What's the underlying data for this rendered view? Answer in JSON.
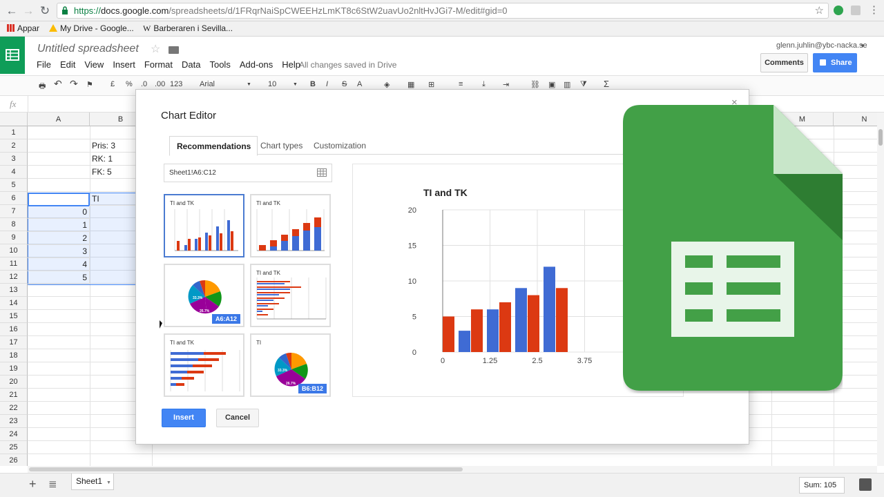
{
  "browser": {
    "url_secure": "https://",
    "url_host": "docs.google.com",
    "url_path": "/spreadsheets/d/1FRqrNaiSpCWEEHzLmKT8c6StW2uavUo2nltHvJGi7-M/edit#gid=0",
    "bookmarks": [
      {
        "label": "Appar",
        "icon": "apps-grid-icon"
      },
      {
        "label": "My Drive - Google...",
        "icon": "drive-icon"
      },
      {
        "label": "Barberaren i Sevilla...",
        "icon": "wikipedia-icon"
      }
    ]
  },
  "app": {
    "title": "Untitled spreadsheet",
    "save_status": "All changes saved in Drive",
    "user_email": "glenn.juhlin@ybc-nacka.se",
    "comments_label": "Comments",
    "share_label": "Share",
    "menu": [
      "File",
      "Edit",
      "View",
      "Insert",
      "Format",
      "Data",
      "Tools",
      "Add-ons",
      "Help"
    ],
    "accent": "#0f9d58",
    "share_color": "#4285f4"
  },
  "toolbar": {
    "currency": "£",
    "percent": "%",
    "dec_less": ".0",
    "dec_more": ".00",
    "format_more": "123",
    "font": "Arial",
    "font_size": "10",
    "bold": "B",
    "italic": "I",
    "strike": "S",
    "text_color": "A",
    "sum": "Σ"
  },
  "formula_bar": {
    "fx": "fx"
  },
  "grid": {
    "columns": [
      "A",
      "B",
      "M",
      "N"
    ],
    "rows": [
      "1",
      "2",
      "3",
      "4",
      "5",
      "6",
      "7",
      "8",
      "9",
      "10",
      "11",
      "12",
      "13",
      "14",
      "15",
      "16",
      "17",
      "18",
      "19",
      "20",
      "21",
      "22",
      "23",
      "24",
      "25",
      "26"
    ],
    "cells": {
      "B2": "Pris: 3",
      "B3": "RK: 1",
      "B4": "FK: 5",
      "B6": "TI",
      "A7": "0",
      "A8": "1",
      "A9": "2",
      "A10": "3",
      "A11": "4",
      "A12": "5"
    }
  },
  "footer": {
    "sheet_name": "Sheet1",
    "sum_label": "Sum: 105"
  },
  "dialog": {
    "title": "Chart Editor",
    "close": "×",
    "tabs": [
      "Recommendations",
      "Chart types",
      "Customization"
    ],
    "range": "Sheet1!A6:C12",
    "thumbnails": [
      {
        "title": "TI and TK",
        "kind": "bar"
      },
      {
        "title": "TI and TK",
        "kind": "stacked-bar"
      },
      {
        "title": "",
        "kind": "pie",
        "tag": "A6:A12",
        "pct1": "33.3%",
        "pct2": "26.7%"
      },
      {
        "title": "TI and TK",
        "kind": "horizontal-bar"
      },
      {
        "title": "TI and TK",
        "kind": "horizontal-bar-2"
      },
      {
        "title": "TI",
        "kind": "pie",
        "tag": "B6:B12",
        "pct1": "33.3%",
        "pct2": "26.7%"
      }
    ],
    "insert_label": "Insert",
    "cancel_label": "Cancel"
  },
  "chart_data": {
    "type": "bar",
    "title": "TI and TK",
    "categories": [
      "0",
      "1.25",
      "2.5",
      "3.75"
    ],
    "x_labels": [
      "0",
      "1.25",
      "2.5",
      "3.75"
    ],
    "series": [
      {
        "color": "#3f6bd4",
        "values": [
          0,
          3,
          6,
          9,
          12
        ]
      },
      {
        "color": "#dc3912",
        "values": [
          5,
          6,
          7,
          8,
          9
        ]
      }
    ],
    "y_ticks": [
      "0",
      "5",
      "10",
      "15",
      "20"
    ],
    "ylim": [
      0,
      20
    ]
  }
}
